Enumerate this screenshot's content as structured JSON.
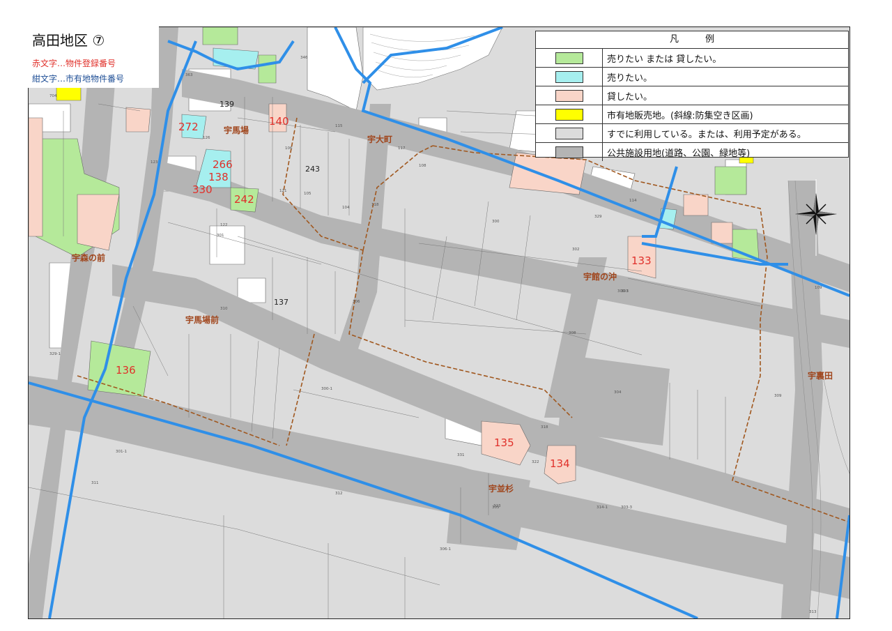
{
  "map": {
    "title": "高田地区 ⑦",
    "note_red": "赤文字…物件登録番号",
    "note_blue": "紺文字…市有地物件番号"
  },
  "legend": {
    "title": "凡例",
    "items": [
      {
        "label": "売りたい または 貸したい。",
        "color": "#b5e99a"
      },
      {
        "label": "売りたい。",
        "color": "#a6efef"
      },
      {
        "label": "貸したい。",
        "color": "#f9d5c8"
      },
      {
        "label": "市有地販売地。(斜線:防集空き区画)",
        "color": "#ffff00"
      },
      {
        "label": "すでに利用している。または、利用予定がある。",
        "color": "#dcdcdc"
      },
      {
        "label": "公共施設用地(道路、公園、緑地等)",
        "color": "#b4b4b4"
      }
    ]
  },
  "area_names": [
    "宇馬場",
    "宇大町",
    "宇森の前",
    "宇館の沖",
    "宇馬場前",
    "宇裏田",
    "宇並杉"
  ],
  "registered_numbers": [
    "272",
    "140",
    "266",
    "138",
    "330",
    "242",
    "133",
    "136",
    "135",
    "134"
  ],
  "city_numbers": [
    "139",
    "243",
    "137"
  ],
  "parcel_numbers": [
    "105",
    "106",
    "104",
    "108",
    "300",
    "301",
    "302",
    "303",
    "304",
    "305",
    "306",
    "308",
    "309",
    "310",
    "311",
    "312",
    "313",
    "318",
    "322",
    "323",
    "329",
    "331",
    "346",
    "363",
    "704",
    "109",
    "118",
    "115",
    "117",
    "114",
    "121",
    "122",
    "123",
    "126",
    "329-1",
    "314-1",
    "300-3",
    "300-1",
    "301-1",
    "303-3",
    "306-1"
  ],
  "colors": {
    "road": "#b4b4b4",
    "used": "#dcdcdc",
    "boundary_blue": "#2f8fe8",
    "district_line": "#a0571e"
  }
}
